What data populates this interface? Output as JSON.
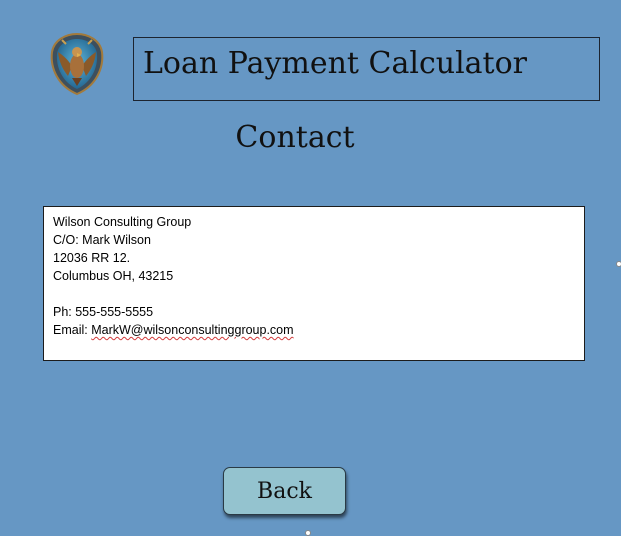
{
  "header": {
    "title": "Loan Payment Calculator",
    "logo_icon": "eagle-crest-icon"
  },
  "page": {
    "subtitle": "Contact"
  },
  "contact": {
    "company": "Wilson Consulting Group",
    "care_of": "C/O: Mark Wilson",
    "address_line": "12036 RR 12.",
    "city_line": "Columbus OH, 43215",
    "phone": "Ph: 555-555-5555",
    "email_label": "Email: ",
    "email_value": "MarkW@wilsonconsultinggroup.com"
  },
  "actions": {
    "back_label": "Back"
  },
  "colors": {
    "background": "#6697c4",
    "button": "#94c3cf",
    "panel": "#ffffff"
  }
}
